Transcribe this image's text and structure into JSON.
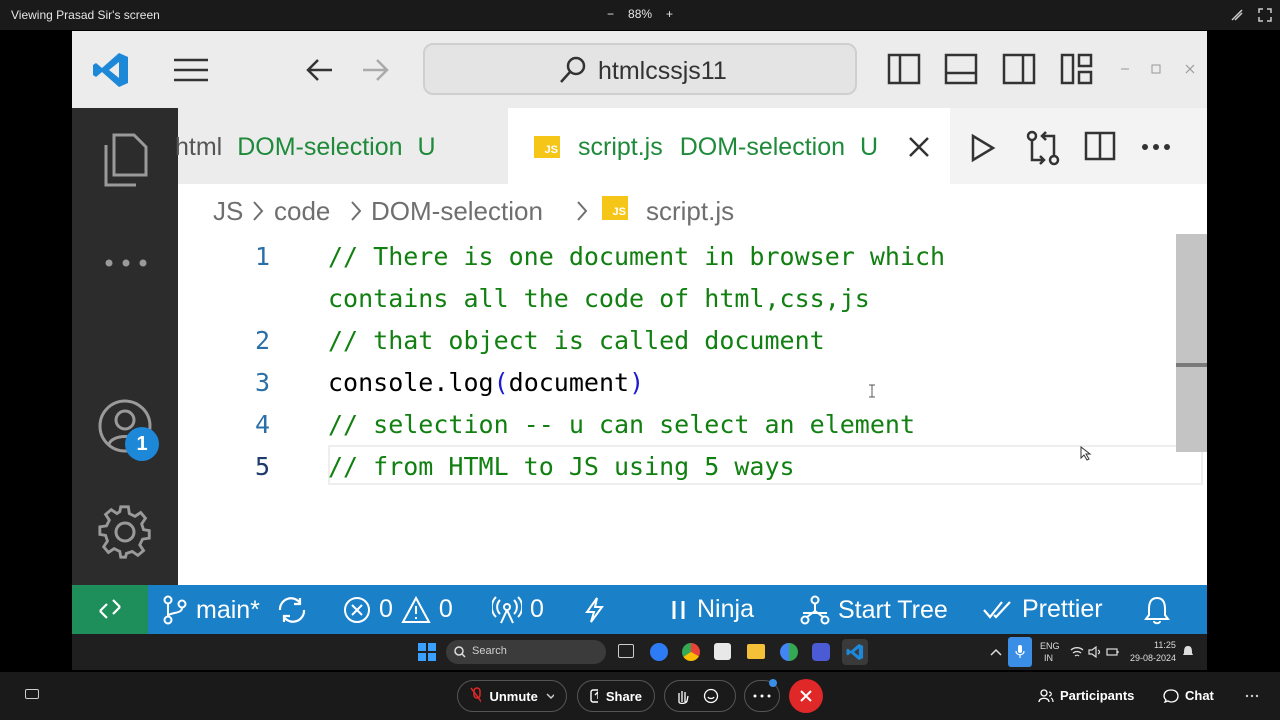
{
  "zoom": {
    "viewing_title": "Viewing Prasad Sir's screen",
    "zoom_minus": "−",
    "zoom_level": "88%",
    "zoom_plus": "+",
    "unmute_label": "Unmute",
    "share_label": "Share",
    "participants_label": "Participants",
    "chat_label": "Chat"
  },
  "vscode": {
    "search_text": "htmlcssjs11",
    "tabs": [
      {
        "name": "html",
        "desc": "DOM-selection",
        "status": "U"
      },
      {
        "name": "script.js",
        "desc": "DOM-selection",
        "status": "U",
        "icon_text": "JS"
      }
    ],
    "breadcrumb": [
      "JS",
      "code",
      "DOM-selection",
      "script.js"
    ],
    "breadcrumb_icon_text": "JS",
    "account_badge": "1",
    "code_lines": [
      {
        "num": "1",
        "text": "// There is one document in browser which"
      },
      {
        "num": "",
        "text": "contains all the code of html,css,js"
      },
      {
        "num": "2",
        "text": "// that object is called document"
      },
      {
        "num": "3",
        "text_a": "console.log",
        "text_b": "(",
        "text_c": "document",
        "text_d": ")"
      },
      {
        "num": "4",
        "text": "// selection -- u can select an element"
      },
      {
        "num": "5",
        "text": "// from HTML to JS using 5 ways"
      }
    ],
    "status": {
      "branch": "main*",
      "errors": "0",
      "warnings": "0",
      "ports": "0",
      "ninja": "Ninja",
      "start_tree": "Start Tree",
      "prettier": "Prettier"
    }
  },
  "taskbar": {
    "search_placeholder": "Search",
    "lang": "ENG",
    "region": "IN",
    "time": "11:25",
    "date": "29-08-2024"
  },
  "colors": {
    "statusbar": "#1a80c8",
    "remote": "#1e8f5a",
    "comment": "#118011",
    "line_number": "#2b6fa8",
    "js_icon": "#f5c518",
    "end_call": "#e02828"
  }
}
